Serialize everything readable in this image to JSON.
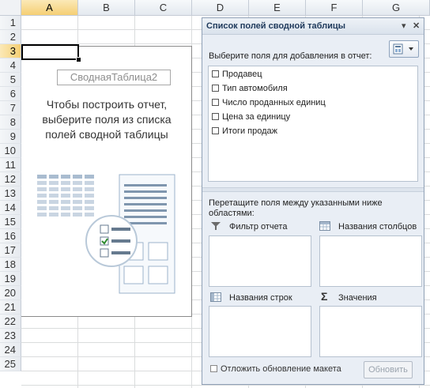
{
  "sheet": {
    "columns": [
      "A",
      "B",
      "C",
      "D",
      "E",
      "F",
      "G"
    ],
    "active_column": "A",
    "rows": [
      "1",
      "2",
      "3",
      "4",
      "5",
      "6",
      "7",
      "8",
      "9",
      "10",
      "11",
      "12",
      "13",
      "14",
      "15",
      "16",
      "17",
      "18",
      "19",
      "20",
      "21",
      "22",
      "23",
      "24",
      "25"
    ],
    "active_row": "3"
  },
  "pivot_placeholder": {
    "name": "СводнаяТаблица2",
    "message": "Чтобы построить отчет, выберите поля из списка полей сводной таблицы"
  },
  "field_list_panel": {
    "title": "Список полей сводной таблицы",
    "choose_label": "Выберите поля для добавления в отчет:",
    "fields": [
      "Продавец",
      "Тип автомобиля",
      "Число проданных единиц",
      "Цена за единицу",
      "Итоги продаж"
    ],
    "drag_label": "Перетащите поля между указанными ниже областями:",
    "areas": {
      "report_filter": "Фильтр отчета",
      "column_labels": "Названия столбцов",
      "row_labels": "Названия строк",
      "values": "Значения"
    },
    "defer_label": "Отложить обновление макета",
    "update_button": "Обновить",
    "icons": {
      "dropdown": "chevron-down-icon",
      "close": "close-icon",
      "layout": "field-layout-icon",
      "filter": "filter-icon",
      "columns": "column-labels-icon",
      "rows": "row-labels-icon",
      "values": "sigma-icon"
    }
  },
  "colors": {
    "active_header": "#f5cf74",
    "panel_background": "#e9eef5",
    "panel_title": "#1e395b"
  }
}
